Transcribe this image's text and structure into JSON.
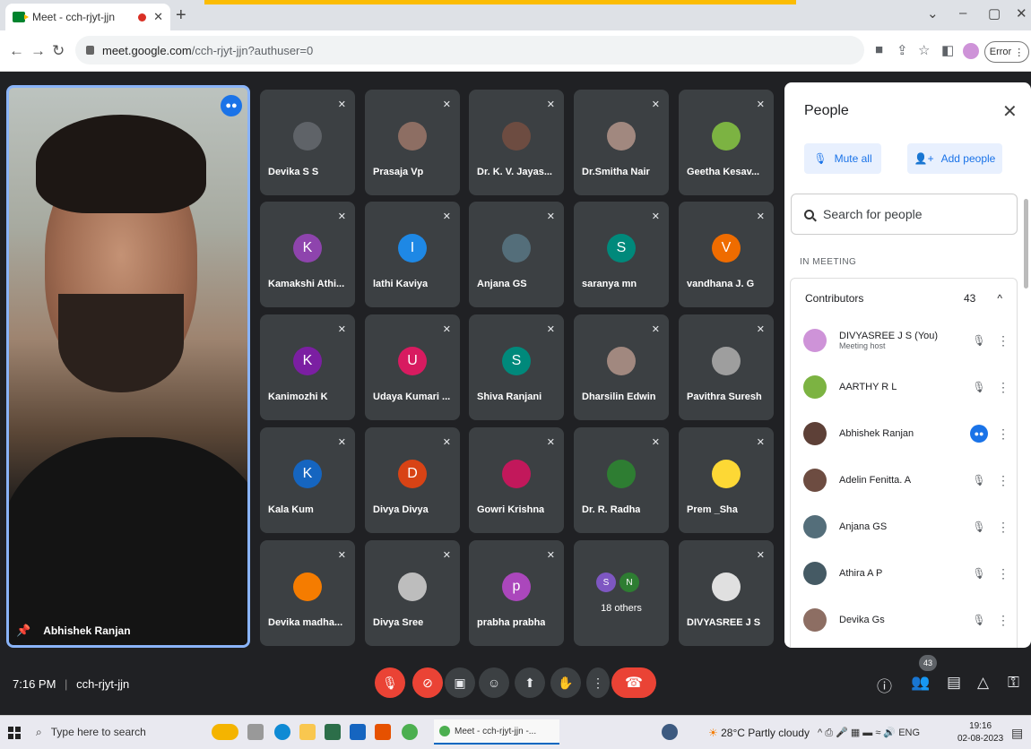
{
  "browser": {
    "tab_title": "Meet - cch-rjyt-jjn",
    "url_host": "meet.google.com",
    "url_path": "/cch-rjyt-jjn?authuser=0",
    "error_label": "Error"
  },
  "main_video": {
    "name": "Abhishek Ranjan"
  },
  "tiles": [
    {
      "name": "Devika S S",
      "initial": "",
      "color": "#5f6368"
    },
    {
      "name": "Prasaja Vp",
      "initial": "",
      "color": "#8d6e63"
    },
    {
      "name": "Dr. K. V. Jayas...",
      "initial": "",
      "color": "#6d4c41"
    },
    {
      "name": "Dr.Smitha Nair",
      "initial": "",
      "color": "#a1887f"
    },
    {
      "name": "Geetha Kesav...",
      "initial": "",
      "color": "#7cb342"
    },
    {
      "name": "Kamakshi Athi...",
      "initial": "K",
      "color": "#8e44ad"
    },
    {
      "name": "lathi Kaviya",
      "initial": "I",
      "color": "#1e88e5"
    },
    {
      "name": "Anjana GS",
      "initial": "",
      "color": "#546e7a"
    },
    {
      "name": "saranya mn",
      "initial": "S",
      "color": "#00897b"
    },
    {
      "name": "vandhana J. G",
      "initial": "V",
      "color": "#ef6c00"
    },
    {
      "name": "Kanimozhi K",
      "initial": "K",
      "color": "#7b1fa2"
    },
    {
      "name": "Udaya Kumari ...",
      "initial": "U",
      "color": "#d81b60"
    },
    {
      "name": "Shiva Ranjani",
      "initial": "S",
      "color": "#00897b"
    },
    {
      "name": "Dharsilin Edwin",
      "initial": "",
      "color": "#a1887f"
    },
    {
      "name": "Pavithra Suresh",
      "initial": "",
      "color": "#9e9e9e"
    },
    {
      "name": "Kala Kum",
      "initial": "K",
      "color": "#1565c0"
    },
    {
      "name": "Divya Divya",
      "initial": "D",
      "color": "#d84315"
    },
    {
      "name": "Gowri Krishna",
      "initial": "",
      "color": "#c2185b"
    },
    {
      "name": "Dr. R. Radha",
      "initial": "",
      "color": "#2e7d32"
    },
    {
      "name": "Prem _Sha",
      "initial": "",
      "color": "#fdd835"
    },
    {
      "name": "Devika madha...",
      "initial": "",
      "color": "#f57c00"
    },
    {
      "name": "Divya Sree",
      "initial": "",
      "color": "#bdbdbd"
    },
    {
      "name": "prabha prabha",
      "initial": "p",
      "color": "#ab47bc"
    },
    {
      "name": "",
      "initial": "",
      "color": "#3c4043"
    },
    {
      "name": "DIVYASREE J S",
      "initial": "",
      "color": "#e0e0e0"
    }
  ],
  "others_tile": {
    "a": "S",
    "b": "N",
    "label": "18 others"
  },
  "people": {
    "title": "People",
    "mute_all": "Mute all",
    "add_people": "Add people",
    "search_placeholder": "Search for people",
    "in_meeting": "IN MEETING",
    "contributors": "Contributors",
    "count": "43",
    "rows": [
      {
        "name": "DIVYASREE J S (You)",
        "sub": "Meeting host",
        "color": "#ce93d8"
      },
      {
        "name": "AARTHY R L",
        "sub": "",
        "color": "#7cb342"
      },
      {
        "name": "Abhishek Ranjan",
        "sub": "",
        "color": "#5d4037"
      },
      {
        "name": "Adelin Fenitta. A",
        "sub": "",
        "color": "#6d4c41"
      },
      {
        "name": "Anjana GS",
        "sub": "",
        "color": "#546e7a"
      },
      {
        "name": "Athira A P",
        "sub": "",
        "color": "#455a64"
      },
      {
        "name": "Devika Gs",
        "sub": "",
        "color": "#8d6e63"
      }
    ]
  },
  "bottom": {
    "time": "7:16 PM",
    "code": "cch-rjyt-jjn",
    "participants_badge": "43"
  },
  "taskbar": {
    "search": "Type here to search",
    "meet_task": "Meet - cch-rjyt-jjn -...",
    "weather": "28°C  Partly cloudy",
    "lang": "ENG",
    "time": "19:16",
    "date": "02-08-2023"
  }
}
